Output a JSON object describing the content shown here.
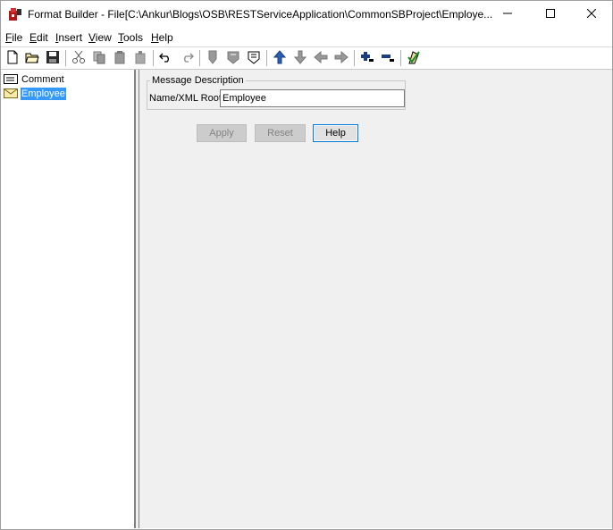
{
  "window": {
    "title": "Format Builder - File[C:\\Ankur\\Blogs\\OSB\\RESTServiceApplication\\CommonSBProject\\Employe...",
    "controls": {
      "minimize_icon": "minimize-icon",
      "maximize_icon": "maximize-icon",
      "close_icon": "close-icon"
    }
  },
  "menu": {
    "items": [
      {
        "mnemonic": "F",
        "rest": "ile"
      },
      {
        "mnemonic": "E",
        "rest": "dit"
      },
      {
        "mnemonic": "I",
        "rest": "nsert"
      },
      {
        "mnemonic": "V",
        "rest": "iew"
      },
      {
        "mnemonic": "T",
        "rest": "ools"
      },
      {
        "mnemonic": "H",
        "rest": "elp"
      }
    ]
  },
  "toolbar": {
    "buttons": [
      "new-file-icon",
      "open-folder-icon",
      "save-icon",
      "cut-icon",
      "copy-icon",
      "paste-icon",
      "paste-disabled-icon",
      "undo-icon",
      "redo-icon",
      "insert-field-icon",
      "insert-group-icon",
      "insert-reference-icon",
      "move-up-icon",
      "move-down-icon",
      "move-left-icon",
      "move-right-icon",
      "expand-icon",
      "collapse-icon",
      "check-icon"
    ]
  },
  "tree": {
    "items": [
      {
        "label": "Comment",
        "icon": "comment-icon",
        "selected": false
      },
      {
        "label": "Employee",
        "icon": "envelope-icon",
        "selected": true
      }
    ]
  },
  "form": {
    "group_title": "Message Description",
    "name_label": "Name/XML Root",
    "name_value": "Employee",
    "apply_label": "Apply",
    "reset_label": "Reset",
    "help_label": "Help"
  },
  "colors": {
    "selection": "#3399ff",
    "panel_bg": "#f0f0f0",
    "focus_border": "#0078d7"
  }
}
